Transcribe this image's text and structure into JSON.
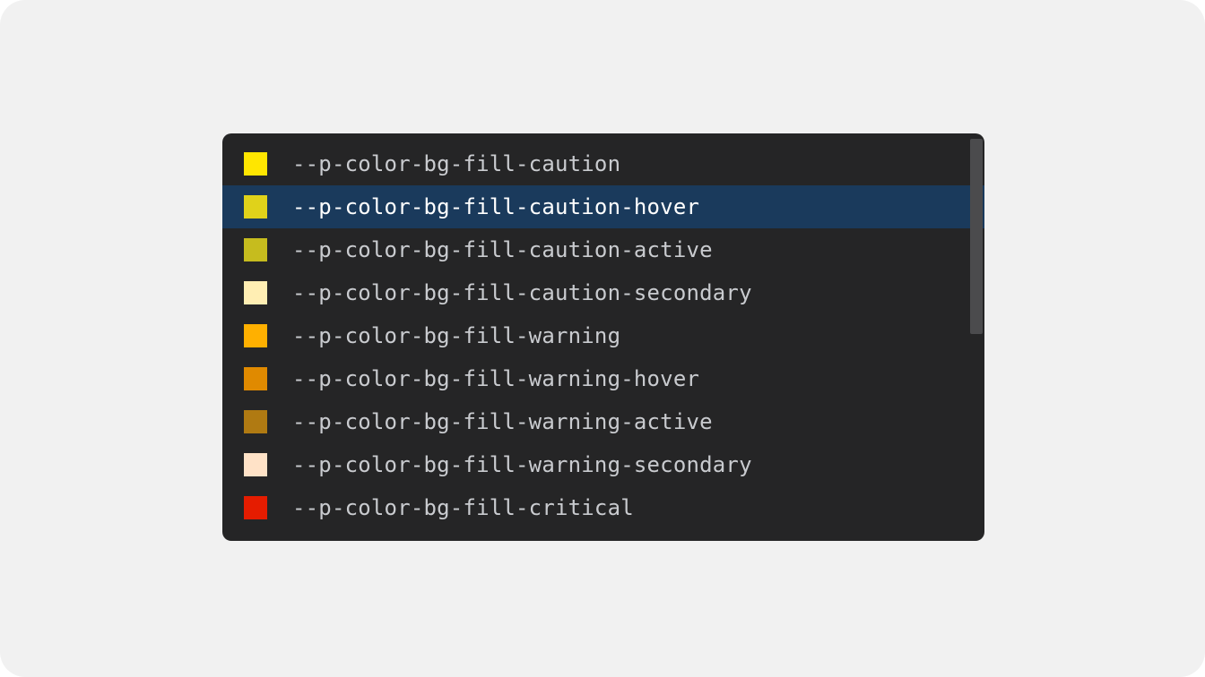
{
  "selected_index": 1,
  "items": [
    {
      "label": "--p-color-bg-fill-caution",
      "swatch": "#ffe600"
    },
    {
      "label": "--p-color-bg-fill-caution-hover",
      "swatch": "#e0d21a"
    },
    {
      "label": "--p-color-bg-fill-caution-active",
      "swatch": "#c6bc1e"
    },
    {
      "label": "--p-color-bg-fill-caution-secondary",
      "swatch": "#ffeeb3"
    },
    {
      "label": "--p-color-bg-fill-warning",
      "swatch": "#ffb000"
    },
    {
      "label": "--p-color-bg-fill-warning-hover",
      "swatch": "#e08a00"
    },
    {
      "label": "--p-color-bg-fill-warning-active",
      "swatch": "#b07a12"
    },
    {
      "label": "--p-color-bg-fill-warning-secondary",
      "swatch": "#ffe2c7"
    },
    {
      "label": "--p-color-bg-fill-critical",
      "swatch": "#e51c00"
    }
  ]
}
